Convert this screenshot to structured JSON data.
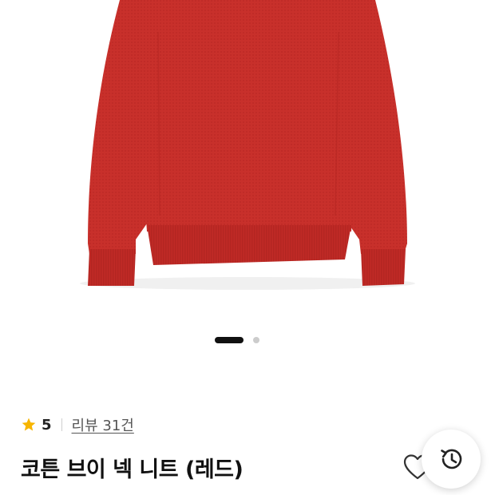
{
  "product": {
    "image_alt": "코튼 브이 넥 니트 (레드)",
    "color": "#c8302b",
    "title": "코튼 브이 넥 니트 (레드)"
  },
  "carousel": {
    "total": 2,
    "current": 1
  },
  "rating": {
    "score": "5",
    "review_text": "리뷰 31건",
    "star_color": "#f7b500"
  },
  "icons": {
    "wishlist": "heart-outline-icon",
    "history": "history-icon"
  }
}
